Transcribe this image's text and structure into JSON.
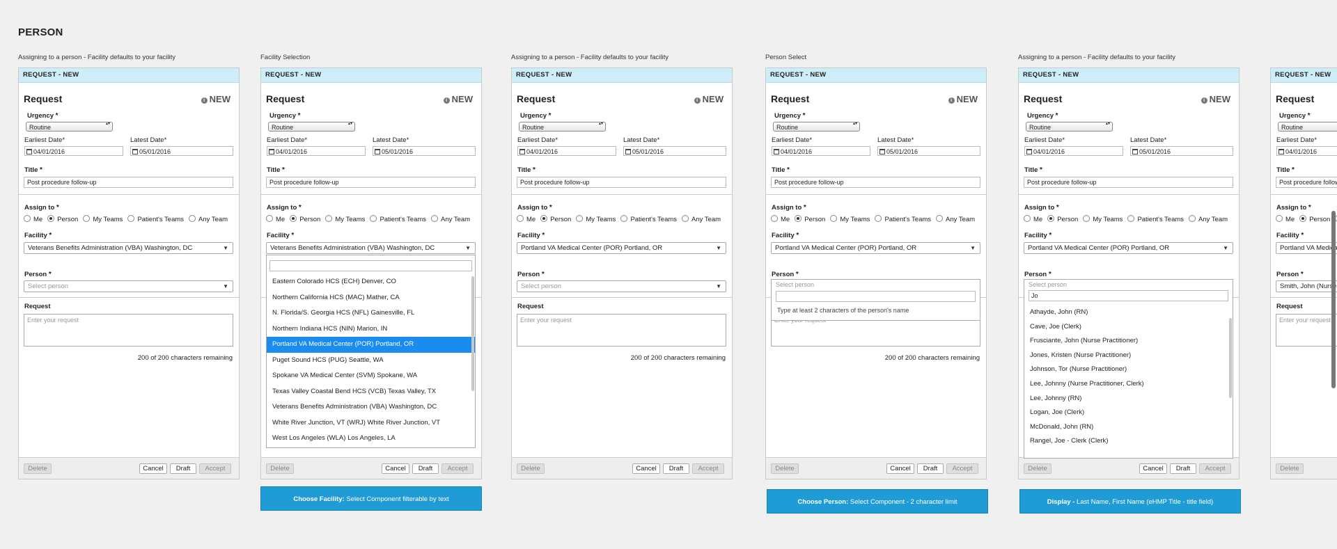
{
  "page": {
    "title": "PERSON"
  },
  "form": {
    "header": "REQUEST - NEW",
    "title": "Request",
    "status": "NEW",
    "urgency_label": "Urgency",
    "urgency_value": "Routine",
    "earliest_label": "Earliest Date*",
    "earliest_value": "04/01/2016",
    "latest_label": "Latest Date*",
    "latest_value": "05/01/2016",
    "title_label": "Title",
    "title_value": "Post procedure follow-up",
    "assign_label": "Assign to",
    "assign_options": [
      "Me",
      "Person",
      "My Teams",
      "Patient's Teams",
      "Any Team"
    ],
    "facility_label": "Facility",
    "person_label": "Person",
    "person_placeholder": "Select person",
    "request_label": "Request",
    "request_placeholder": "Enter your request",
    "remaining": "200 of 200 characters remaining",
    "buttons": {
      "delete": "Delete",
      "cancel": "Cancel",
      "draft": "Draft",
      "accept": "Accept"
    }
  },
  "screens": [
    {
      "caption": "Assigning to a person - Facility defaults to your facility",
      "facility": "Veterans Benefits Administration (VBA) Washington, DC"
    },
    {
      "caption": "Facility Selection",
      "facility": "Veterans Benefits Administration (VBA) Washington, DC"
    },
    {
      "caption": "Assigning to a person - Facility defaults to your facility",
      "facility": "Portland VA Medical Center (POR) Portland, OR"
    },
    {
      "caption": "Person Select",
      "facility": "Portland VA Medical Center (POR) Portland, OR"
    },
    {
      "caption": "Assigning to a person - Facility defaults to your facility",
      "facility": "Portland VA Medical Center (POR) Portland, OR"
    },
    {
      "facility": "Portland VA Medical Center (POR) Portland, OR",
      "person": "Smith, John (Nurse Practitioner)"
    }
  ],
  "facility_list": [
    "Eastern Colorado HCS (ECH) Denver, CO",
    "Northern California HCS (MAC) Mather, CA",
    "N. Florida/S. Georgia HCS (NFL) Gainesville, FL",
    "Northern Indiana HCS (NIN) Marion, IN",
    "Portland VA Medical Center (POR) Portland, OR",
    "Puget Sound HCS (PUG) Seattle, WA",
    "Spokane VA Medical Center (SVM) Spokane, WA",
    "Texas Valley Coastal Bend HCS (VCB) Texas Valley, TX",
    "Veterans Benefits Administration (VBA) Washington, DC",
    "White River Junction, VT (WRJ) White River Junction, VT",
    "West Los Angeles (WLA) Los Angeles, LA"
  ],
  "person_select": {
    "placeholder": "Select person",
    "hint": "Type at least 2 characters of the person's name"
  },
  "person_search": {
    "query": "Jo",
    "results": [
      "Athayde, John (RN)",
      "Cave, Joe (Clerk)",
      "Frusciante, John (Nurse Practitioner)",
      "Jones, Kristen (Nurse Practitioner)",
      "Johnson, Tor (Nurse Practitioner)",
      "Lee, Johnny (Nurse Practitioner, Clerk)",
      "Lee, Johnny (RN)",
      "Logan, Joe (Clerk)",
      "McDonald, John (RN)",
      "Rangel, Joe - Clerk (Clerk)"
    ]
  },
  "annotations": [
    {
      "bold": "Choose Facility:",
      "rest": " Select Component filterable by text"
    },
    {
      "bold": "Choose Person:",
      "rest": " Select Component - 2 character limit"
    },
    {
      "bold": "Display -",
      "rest": " Last Name, First Name (eHMP Title - title field)"
    }
  ],
  "colors": {
    "header_bg": "#cdeef9",
    "accent": "#1f9bd6",
    "highlight": "#1a8cf0",
    "page_bg": "#f0f0f0"
  }
}
